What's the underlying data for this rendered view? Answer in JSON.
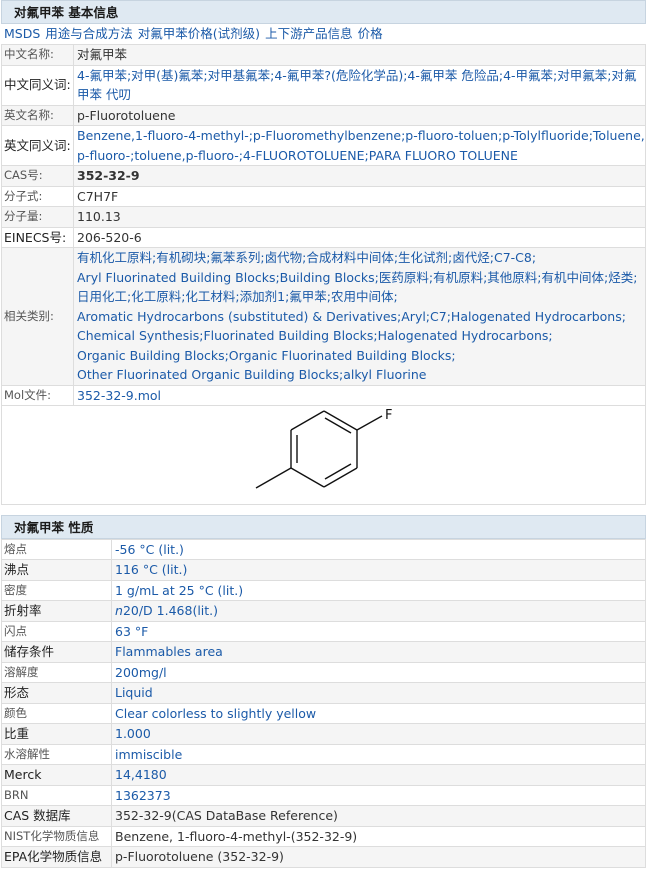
{
  "basic": {
    "header": "对氟甲苯 基本信息",
    "links": [
      "MSDS",
      "用途与合成方法",
      "对氟甲苯价格(试剂级)",
      "上下游产品信息",
      "价格"
    ],
    "rows": [
      {
        "label": "中文名称:",
        "value": "对氟甲苯"
      },
      {
        "label": "中文同义词:",
        "value": "4-氟甲苯;对甲(基)氟苯;对甲基氟苯;4-氟甲苯?(危险化学品);4-氟甲苯 危险品;4-甲氟苯;对甲氟苯;对氟甲苯 代叨"
      },
      {
        "label": "英文名称:",
        "value": "p-Fluorotoluene"
      },
      {
        "label": "英文同义词:",
        "value": "Benzene,1-fluoro-4-methyl-;p-Fluoromethylbenzene;p-fluoro-toluen;p-Tolylfluoride;Toluene, p-fluoro-;toluene,p-fluoro-;4-FLUOROTOLUENE;PARA FLUORO TOLUENE"
      },
      {
        "label": "CAS号:",
        "value": "352-32-9"
      },
      {
        "label": "分子式:",
        "value": "C7H7F"
      },
      {
        "label": "分子量:",
        "value": "110.13"
      },
      {
        "label": "EINECS号:",
        "value": "206-520-6"
      },
      {
        "label": "相关类别:",
        "lines": [
          "有机化工原料;有机砌块;氟苯系列;卤代物;合成材料中间体;生化试剂;卤代烃;C7-C8;",
          "Aryl Fluorinated Building Blocks;Building Blocks;医药原料;有机原料;其他原料;有机中间体;烃类;",
          "日用化工;化工原料;化工材料;添加剂1;氟甲苯;农用中间体;",
          "Aromatic Hydrocarbons (substituted) & Derivatives;Aryl;C7;Halogenated Hydrocarbons;",
          "Chemical Synthesis;Fluorinated Building Blocks;Halogenated Hydrocarbons;",
          "Organic Building Blocks;Organic Fluorinated Building Blocks;",
          "Other Fluorinated Organic Building Blocks;alkyl Fluorine"
        ]
      },
      {
        "label": "Mol文件:",
        "value": "352-32-9.mol"
      }
    ],
    "structure_atom": "F"
  },
  "props": {
    "header": "对氟甲苯 性质",
    "rows": [
      {
        "label": "熔点",
        "value": "-56 °C (lit.)"
      },
      {
        "label": "沸点",
        "value": "116 °C (lit.)"
      },
      {
        "label": "密度",
        "value": "1 g/mL at 25 °C (lit.)"
      },
      {
        "label": "折射率",
        "prefix": "n",
        "value": "20/D 1.468(lit.)"
      },
      {
        "label": "闪点",
        "value": "63 °F"
      },
      {
        "label": "储存条件",
        "value": "Flammables area"
      },
      {
        "label": "溶解度",
        "value": "200mg/l"
      },
      {
        "label": "形态",
        "value": "Liquid"
      },
      {
        "label": "颜色",
        "value": "Clear colorless to slightly yellow"
      },
      {
        "label": "比重",
        "value": "1.000"
      },
      {
        "label": "水溶解性",
        "value": "immiscible"
      },
      {
        "label": "Merck",
        "value": "14,4180"
      },
      {
        "label": "BRN",
        "value": "1362373"
      },
      {
        "label": "CAS 数据库",
        "value": "352-32-9(CAS DataBase Reference)"
      },
      {
        "label": "NIST化学物质信息",
        "value": "Benzene, 1-fluoro-4-methyl-(352-32-9)"
      },
      {
        "label": "EPA化学物质信息",
        "value": "p-Fluorotoluene (352-32-9)"
      }
    ]
  }
}
